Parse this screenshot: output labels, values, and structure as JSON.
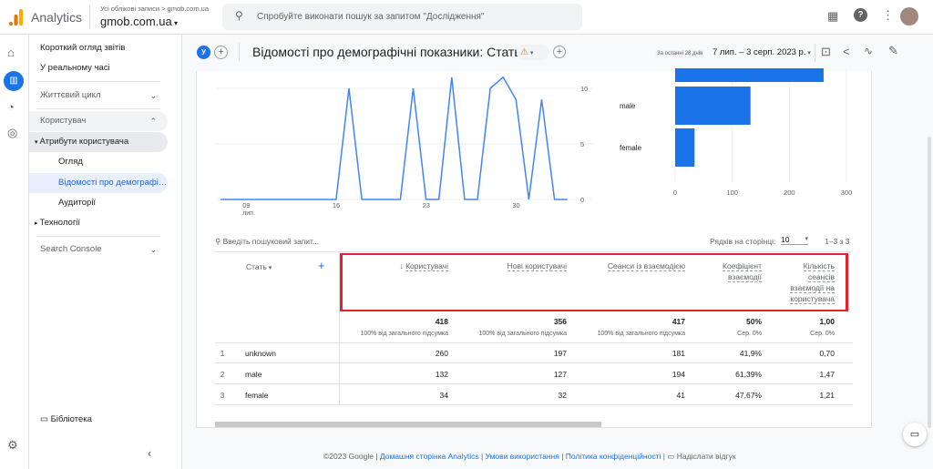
{
  "topbar": {
    "app_name": "Analytics",
    "breadcrumb": "Усі облікові записи > gmob.com.ua",
    "property": "gmob.com.ua",
    "search_placeholder": "Спробуйте виконати пошук за запитом \"Дослідження\""
  },
  "nav": {
    "items": [
      {
        "label": "Короткий огляд звітів"
      },
      {
        "label": "У реальному часі"
      },
      {
        "label": "Життєвий цикл"
      },
      {
        "label": "Користувач"
      },
      {
        "label": "Атрибути користувача"
      },
      {
        "label": "Огляд"
      },
      {
        "label": "Відомості про демографічні показники"
      },
      {
        "label": "Аудиторії"
      },
      {
        "label": "Технології"
      },
      {
        "label": "Search Console"
      }
    ],
    "library": "Бібліотека"
  },
  "header": {
    "avatar_letter": "У",
    "title": "Відомості про демографічні показники: Стать",
    "range_label": "За останні 28 днів",
    "date_range": "7 лип. – 3 серп. 2023 р."
  },
  "chart_data": [
    {
      "type": "line",
      "x": [
        "07.07",
        "08.07",
        "09.07",
        "10.07",
        "11.07",
        "12.07",
        "13.07",
        "14.07",
        "15.07",
        "16.07",
        "17.07",
        "18.07",
        "19.07",
        "20.07",
        "21.07",
        "22.07",
        "23.07",
        "24.07",
        "25.07",
        "26.07",
        "27.07",
        "28.07",
        "29.07",
        "30.07",
        "31.07",
        "01.08",
        "02.08",
        "03.08"
      ],
      "values": [
        0,
        0,
        0,
        0,
        0,
        0,
        0,
        0,
        0,
        0,
        10,
        0,
        0,
        0,
        0,
        10,
        0,
        0,
        11,
        0,
        0,
        10,
        11,
        9,
        0,
        9,
        0,
        0
      ],
      "x_ticks": [
        "09",
        "16",
        "23",
        "30"
      ],
      "x_tick_sub": "лип.",
      "y_ticks": [
        0,
        5,
        10
      ],
      "ylim": [
        0,
        11
      ],
      "color": "#4285f4",
      "grid": true
    },
    {
      "type": "bar",
      "orientation": "horizontal",
      "categories": [
        "unknown",
        "male",
        "female"
      ],
      "values": [
        260,
        132,
        34
      ],
      "x_ticks": [
        0,
        100,
        200,
        300
      ],
      "xlim": [
        0,
        300
      ],
      "color": "#1a73e8",
      "grid": true
    }
  ],
  "table": {
    "search_placeholder": "Введіть пошуковий запит...",
    "rows_per_page_label": "Рядків на сторінці:",
    "rows_per_page": "10",
    "pagination": "1–3 з 3",
    "dimension": "Стать",
    "columns": [
      "Користувачі",
      "Нові користувачі",
      "Сеанси із взаємодією",
      "Коефіцієнт взаємодії",
      "Кількість сеансів взаємодії на користувача"
    ],
    "totals": [
      "418",
      "356",
      "417",
      "50%",
      "1,00"
    ],
    "totals_sub": [
      "100% від загального підсумка",
      "100% від загального підсумка",
      "100% від загального підсумка",
      "Сер. 0%",
      "Сер. 0%"
    ],
    "rows": [
      {
        "n": "1",
        "name": "unknown",
        "cells": [
          "260",
          "197",
          "181",
          "41,9%",
          "0,70"
        ]
      },
      {
        "n": "2",
        "name": "male",
        "cells": [
          "132",
          "127",
          "194",
          "61,39%",
          "1,47"
        ]
      },
      {
        "n": "3",
        "name": "female",
        "cells": [
          "34",
          "32",
          "41",
          "47,67%",
          "1,21"
        ]
      }
    ]
  },
  "footer": {
    "copyright": "©2023 Google |",
    "links": [
      "Домашня сторінка Analytics",
      "Умови використання",
      "Політика конфіденційності"
    ],
    "feedback": "Надіслати відгук"
  }
}
